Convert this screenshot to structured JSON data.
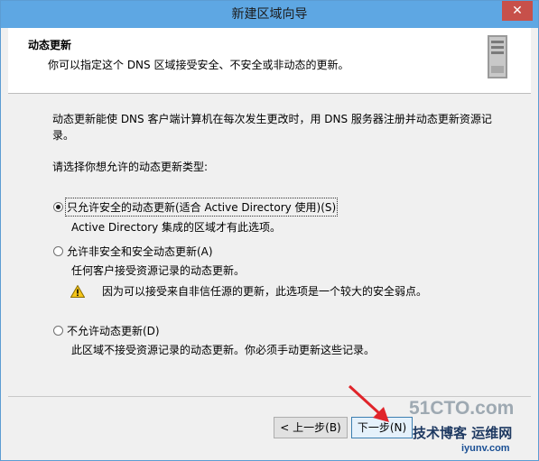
{
  "window": {
    "title": "新建区域向导",
    "close_glyph": "✕"
  },
  "header": {
    "title": "动态更新",
    "description": "你可以指定这个 DNS 区域接受安全、不安全或非动态的更新。",
    "icon": "server-icon"
  },
  "content": {
    "intro_line1": "动态更新能使 DNS 客户端计算机在每次发生更改时，用 DNS 服务器注册并动态更新资源记",
    "intro_line2": "录。",
    "prompt": "请选择你想允许的动态更新类型:",
    "options": [
      {
        "label": "只允许安全的动态更新(适合 Active Directory 使用)(S)",
        "description": "Active Directory 集成的区域才有此选项。",
        "selected": true
      },
      {
        "label": "允许非安全和安全动态更新(A)",
        "description": "任何客户接受资源记录的动态更新。",
        "warning": "因为可以接受来自非信任源的更新，此选项是一个较大的安全弱点。",
        "selected": false
      },
      {
        "label": "不允许动态更新(D)",
        "description": "此区域不接受资源记录的动态更新。你必须手动更新这些记录。",
        "selected": false
      }
    ]
  },
  "buttons": {
    "back": "< 上一步(B)",
    "next": "下一步(N)"
  },
  "watermark": {
    "brand": "51CTO.com",
    "slogan": "技术博客  运维网",
    "site": "iyunv.com"
  },
  "colors": {
    "titlebar": "#5ea7e3",
    "close": "#c7504a",
    "arrow": "#e0242a"
  }
}
